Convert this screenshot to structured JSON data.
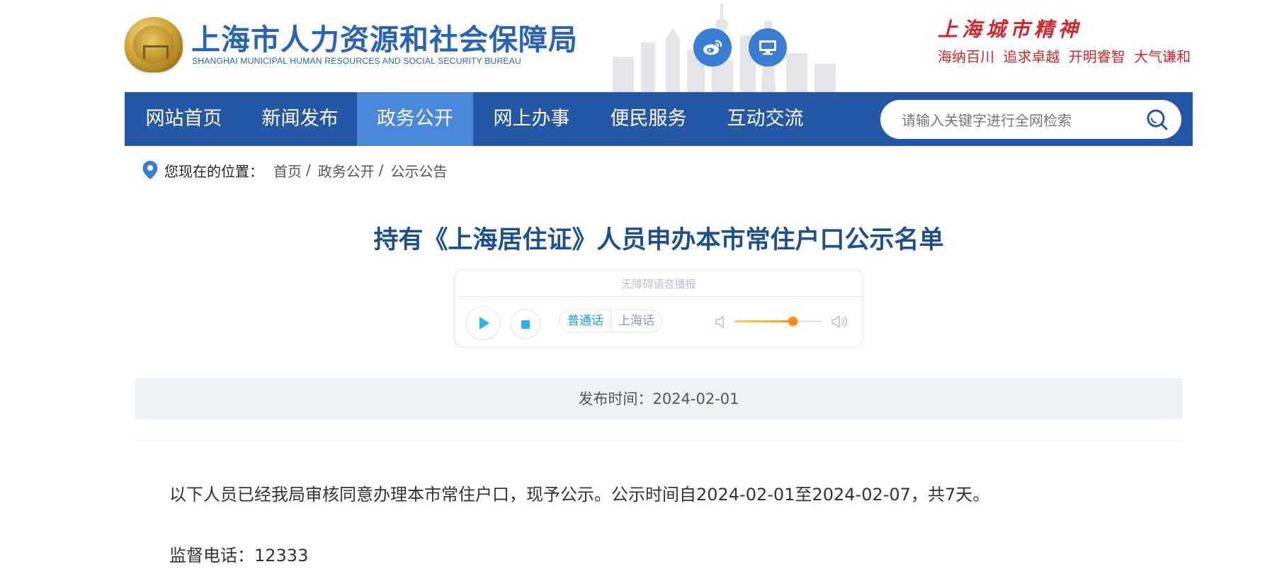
{
  "header": {
    "org_name_cn": "上海市人力资源和社会保障局",
    "org_name_en": "SHANGHAI MUNICIPAL HUMAN RESOURCES AND SOCIAL SECURITY BUREAU",
    "icons": [
      "weibo-icon",
      "monitor-icon"
    ],
    "slogan_title": "上海城市精神",
    "slogan_items": [
      "海纳百川",
      "追求卓越",
      "开明睿智",
      "大气谦和"
    ]
  },
  "nav": {
    "items": [
      {
        "label": "网站首页",
        "active": false
      },
      {
        "label": "新闻发布",
        "active": false
      },
      {
        "label": "政务公开",
        "active": true
      },
      {
        "label": "网上办事",
        "active": false
      },
      {
        "label": "便民服务",
        "active": false
      },
      {
        "label": "互动交流",
        "active": false
      }
    ],
    "search_placeholder": "请输入关键字进行全网检索"
  },
  "breadcrumb": {
    "label": "您现在的位置：",
    "items": [
      "首页",
      "政务公开",
      "公示公告"
    ],
    "separator": "/"
  },
  "article": {
    "title": "持有《上海居住证》人员申办本市常住户口公示名单",
    "player": {
      "title": "无障碍语音播报",
      "lang_options": [
        "普通话",
        "上海话"
      ],
      "lang_selected": "普通话",
      "volume": 0.66
    },
    "publish": "发布时间：2024-02-01",
    "paragraphs": [
      "以下人员已经我局审核同意办理本市常住户口，现予公示。公示时间自2024-02-01至2024-02-07，共7天。",
      "监督电话：12333"
    ]
  },
  "colors": {
    "nav_bg": "#2557a7",
    "nav_active": "#4a88d9",
    "brand_blue": "#2a63b4",
    "title_blue": "#1d4f8e",
    "slogan_red": "#d4252b",
    "accent_cyan": "#1aa2e8",
    "volume_orange": "#f7881a"
  }
}
